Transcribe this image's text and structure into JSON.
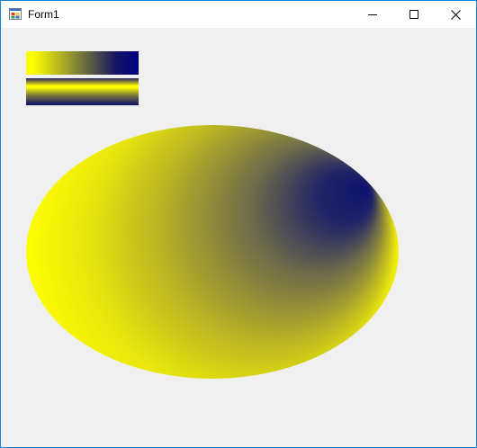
{
  "window": {
    "title": "Form1",
    "icon": "winforms-app-icon",
    "controls": {
      "minimize_icon": "minimize-icon",
      "maximize_icon": "maximize-icon",
      "close_icon": "close-icon"
    }
  },
  "colors": {
    "titlebar_bg": "#ffffff",
    "client_bg": "#f0f0f0",
    "window_border": "#1883d7",
    "gradient_start": "#ffff00",
    "gradient_end": "#000080"
  },
  "shapes": {
    "horizontal_gradient_rect": "linear-gradient-horizontal",
    "vertical_gradient_rect": "linear-gradient-vertical",
    "ellipse": "path-gradient-ellipse"
  }
}
